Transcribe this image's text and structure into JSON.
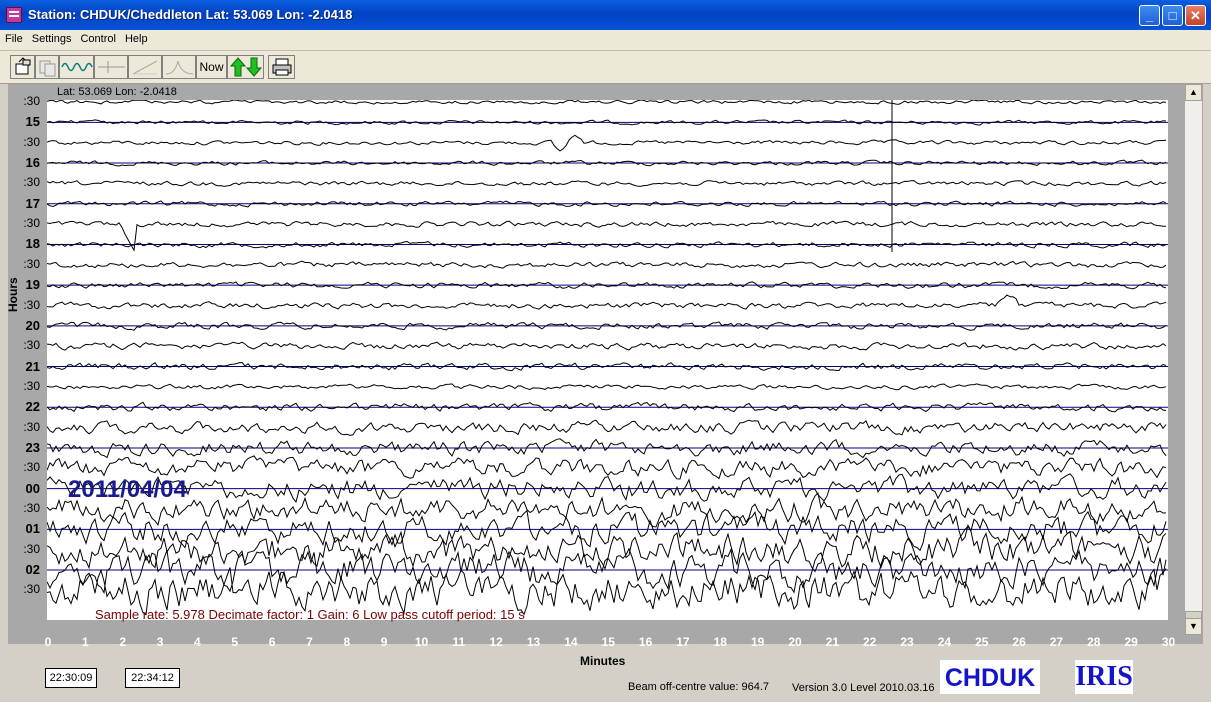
{
  "window": {
    "title": "Station: CHDUK/Cheddleton Lat: 53.069 Lon: -2.0418"
  },
  "menu": [
    "File",
    "Settings",
    "Control",
    "Help"
  ],
  "toolbar": {
    "now_label": "Now"
  },
  "plot": {
    "header_text": "Lat: 53.069 Lon: -2.0418",
    "y_axis_label": "Hours",
    "hour_labels": [
      ":30",
      "15",
      ":30",
      "16",
      ":30",
      "17",
      ":30",
      "18",
      ":30",
      "19",
      ":30",
      "20",
      ":30",
      "21",
      ":30",
      "22",
      ":30",
      "23",
      ":30",
      "00",
      ":30",
      "01",
      ":30",
      "02",
      ":30"
    ],
    "x_axis_label": "Minutes",
    "x_ticks": [
      "0",
      "1",
      "2",
      "3",
      "4",
      "5",
      "6",
      "7",
      "8",
      "9",
      "10",
      "11",
      "12",
      "13",
      "14",
      "15",
      "16",
      "17",
      "18",
      "19",
      "20",
      "21",
      "22",
      "23",
      "24",
      "25",
      "26",
      "27",
      "28",
      "29",
      "30"
    ],
    "date": "2011/04/04",
    "status_text": "Sample rate: 5.978  Decimate factor: 1  Gain: 6  Low pass cutoff period: 15 s"
  },
  "footer": {
    "time_start": "22:30:09",
    "time_end": "22:34:12",
    "beam_text": "Beam off-centre value: 964.7",
    "version_text": "Version 3.0 Level 2010.03.16",
    "station_logo": "CHDUK",
    "iris_logo": "IRIS"
  },
  "colors": {
    "trace": "#000000",
    "hour_line": "#000080",
    "date": "#1a1a8c",
    "status": "#7a0000",
    "plot_bg": "#ffffff",
    "frame": "#a8a8a8"
  }
}
